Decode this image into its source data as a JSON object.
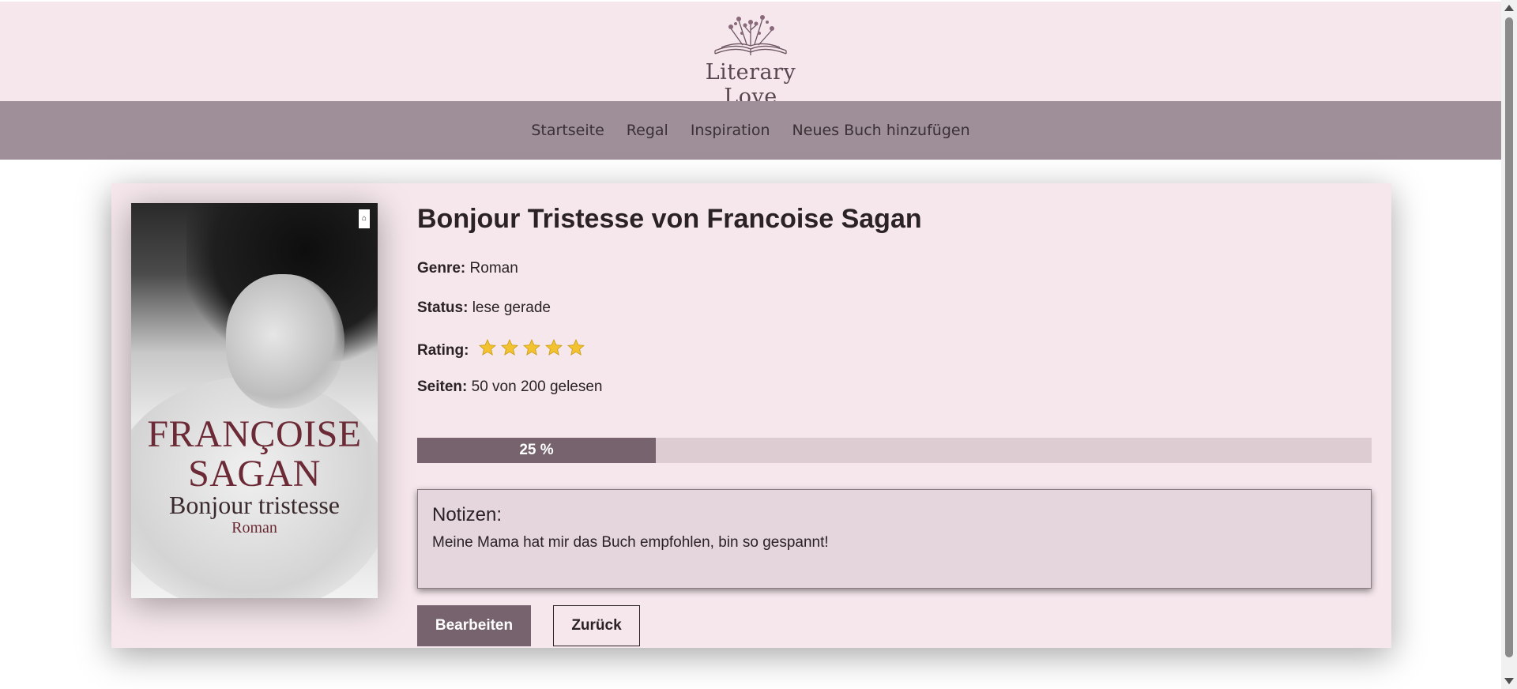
{
  "header": {
    "logo_text": "Literary Love",
    "logo_icon": "open-book-with-flowers-icon"
  },
  "nav": {
    "items": [
      "Startseite",
      "Regal",
      "Inspiration",
      "Neues Buch hinzufügen"
    ]
  },
  "book": {
    "title": "Bonjour Tristesse von Francoise Sagan",
    "cover": {
      "author": "FRANÇOISE SAGAN",
      "title": "Bonjour tristesse",
      "subtitle": "Roman"
    },
    "genre_label": "Genre:",
    "genre": "Roman",
    "status_label": "Status:",
    "status": "lese gerade",
    "rating_label": "Rating:",
    "rating": 5,
    "rating_max": 5,
    "pages_label": "Seiten:",
    "pages_text": "50 von 200 gelesen",
    "progress_percent": 25,
    "progress_text": "25 %"
  },
  "notes": {
    "title": "Notizen:",
    "text": "Meine Mama hat mir das Buch empfohlen, bin so gespannt!"
  },
  "buttons": {
    "edit": "Bearbeiten",
    "back": "Zurück"
  },
  "colors": {
    "header_bg": "#f5e7ec",
    "nav_bg": "#9f8f98",
    "accent": "#76636e",
    "progress_track": "#ddccd2",
    "star": "#f2c230"
  }
}
